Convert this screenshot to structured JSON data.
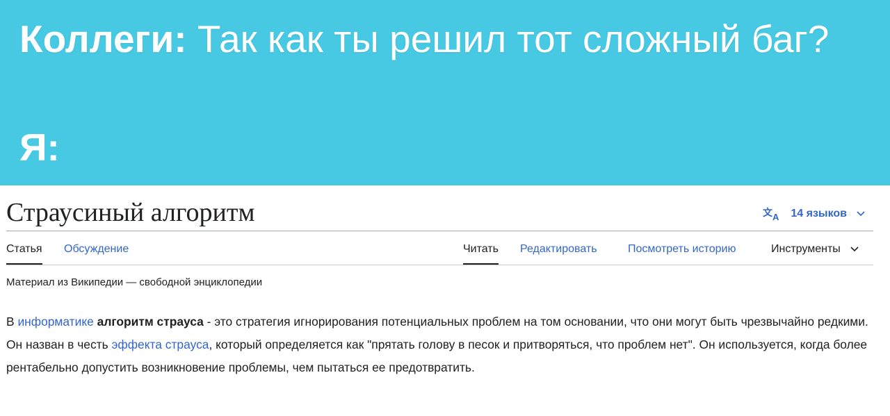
{
  "meme": {
    "line1_speaker": "Коллеги:",
    "line1_text": " Так как ты решил тот сложный баг?",
    "line2_speaker": "Я:"
  },
  "wiki": {
    "title": "Страусиный алгоритм",
    "languages_label": "14 языков",
    "tabs": {
      "article": "Статья",
      "talk": "Обсуждение",
      "read": "Читать",
      "edit": "Редактировать",
      "history": "Посмотреть историю",
      "tools": "Инструменты"
    },
    "tagline": "Материал из Википедии — свободной энциклопедии",
    "paragraph": {
      "t1": "В ",
      "link1": "информатике",
      "t2": " ",
      "bold1": "алгоритм страуса",
      "t3": " - это стратегия игнорирования потенциальных проблем на том основании, что они могут быть чрезвычайно редкими. Он назван в честь ",
      "link2": "эффекта страуса",
      "t4": ", который определяется как \"прятать голову в песок и притворяться, что проблем нет\". Он используется, когда более рентабельно допустить возникновение проблемы, чем пытаться ее предотвратить."
    }
  },
  "colors": {
    "header_bg": "#48c9e3",
    "link": "#3366cc",
    "text": "#202122"
  },
  "icons": {
    "languages": "translate-icon",
    "dropdown": "chevron-down-icon"
  }
}
